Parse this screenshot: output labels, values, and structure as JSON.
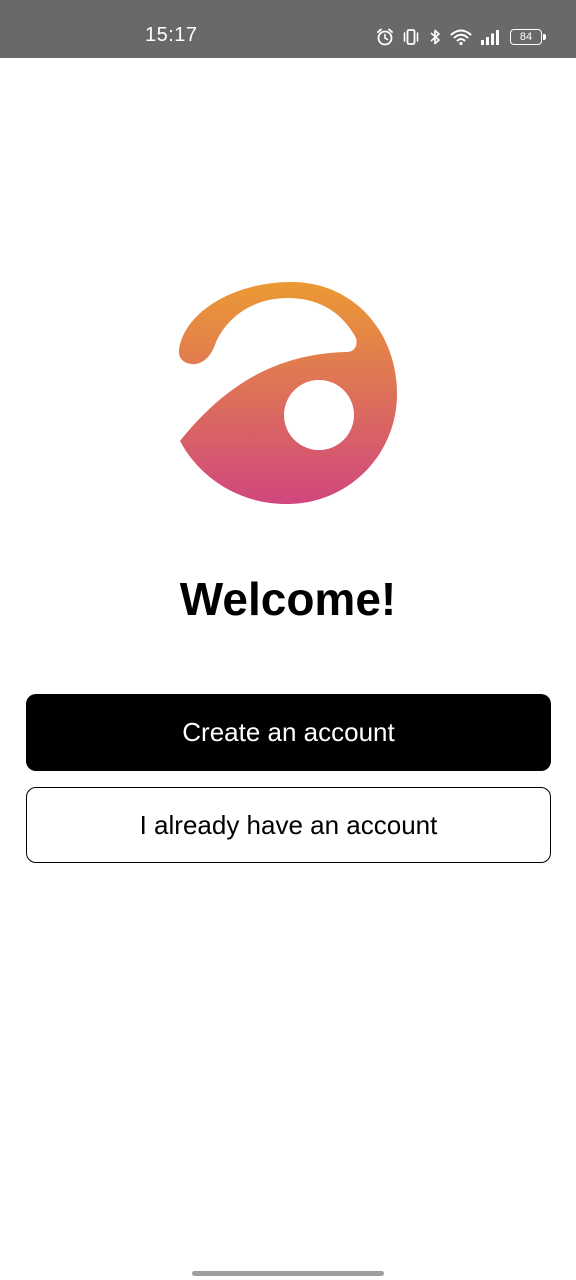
{
  "status_bar": {
    "time": "15:17",
    "battery_level": "84",
    "icons": [
      "alarm-icon",
      "vibrate-icon",
      "bluetooth-icon",
      "wifi-icon",
      "signal-icon",
      "battery-icon"
    ]
  },
  "logo": {
    "gradient_top": "#EB9A34",
    "gradient_bottom": "#D0477E"
  },
  "welcome": {
    "title": "Welcome!"
  },
  "actions": {
    "create_account_label": "Create an account",
    "existing_account_label": "I already have an account"
  },
  "colors": {
    "status_bar_bg": "#696969",
    "primary_button_bg": "#000000",
    "page_bg": "#FFFFFF"
  }
}
